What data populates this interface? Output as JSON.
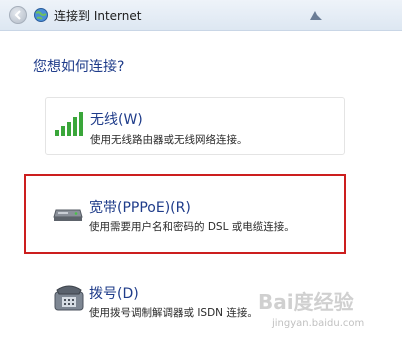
{
  "window": {
    "title": "连接到 Internet"
  },
  "main": {
    "question": "您想如何连接?"
  },
  "options": [
    {
      "title": "无线(W)",
      "description": "使用无线路由器或无线网络连接。",
      "icon": "wireless-signal-icon"
    },
    {
      "title": "宽带(PPPoE)(R)",
      "description": "使用需要用户名和密码的 DSL 或电缆连接。",
      "icon": "broadband-modem-icon"
    },
    {
      "title": "拨号(D)",
      "description": "使用拨号调制解调器或 ISDN 连接。",
      "icon": "dialup-phone-icon"
    }
  ],
  "watermark": {
    "brand": "Bai度经验",
    "url": "jingyan.baidu.com"
  },
  "colors": {
    "accent_blue": "#1f3c8a",
    "highlight_red": "#cc1e1e",
    "signal_green": "#3aa63a"
  }
}
